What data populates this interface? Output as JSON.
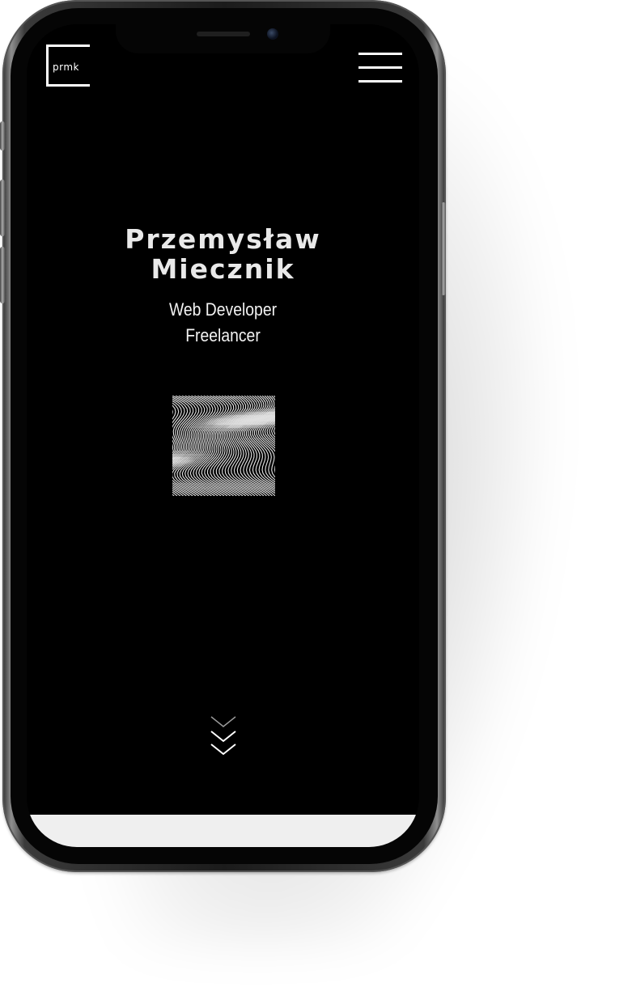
{
  "header": {
    "logo_text": "prmk"
  },
  "hero": {
    "name_line1": "Przemysław",
    "name_line2": "Miecznik",
    "subtitle_line1": "Web Developer",
    "subtitle_line2": "Freelancer"
  },
  "icons": {
    "menu": "hamburger-menu-icon",
    "scroll": "chevron-down-icon",
    "pattern": "wave-pattern-image"
  },
  "colors": {
    "screen_background": "#000000",
    "text": "#ffffff",
    "bottom_bar": "#efefef"
  }
}
